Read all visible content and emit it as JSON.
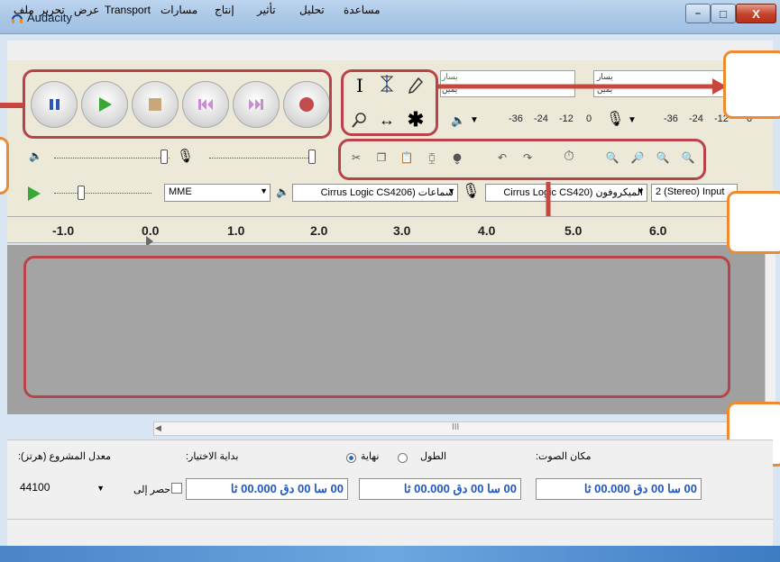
{
  "window": {
    "title": "Audacity",
    "controls": {
      "minimize": "–",
      "maximize": "□",
      "close": "X"
    }
  },
  "menu": [
    "ملف",
    "تحرير",
    "عرض",
    "Transport",
    "مسارات",
    "إنتاج",
    "تأثير",
    "تحليل",
    "مساعدة"
  ],
  "meters": {
    "play_left": "يسار",
    "play_right": "يمين",
    "rec_left": "يسار",
    "rec_right": "يمين",
    "play_scale": [
      "-36",
      "-24",
      "-12",
      "0"
    ],
    "rec_scale": [
      "-36",
      "-24",
      "-12",
      "0"
    ]
  },
  "devices": {
    "host": "MME",
    "output": "سماعات (Cirrus Logic CS4206",
    "input": "الميكروفون (Cirrus Logic CS420",
    "channels": "2 (Stereo) Input"
  },
  "ruler": [
    "-1.0",
    "0.0",
    "1.0",
    "2.0",
    "3.0",
    "4.0",
    "5.0",
    "6.0"
  ],
  "hscroll_grip": "III",
  "selection": {
    "rate_label": "معدل المشروع (هرتز):",
    "rate_value": "44100",
    "snap_label": "حصر إلى",
    "start_label": "بداية الاختيار:",
    "end_label": "نهاية",
    "length_label": "الطول",
    "position_label": "مكان الصوت:",
    "start_time": "00 سا 00 دق 00.000 ثا",
    "end_time": "00 سا 00 دق 00.000 ثا",
    "position_time": "00 سا 00 دق 00.000 ثا"
  }
}
